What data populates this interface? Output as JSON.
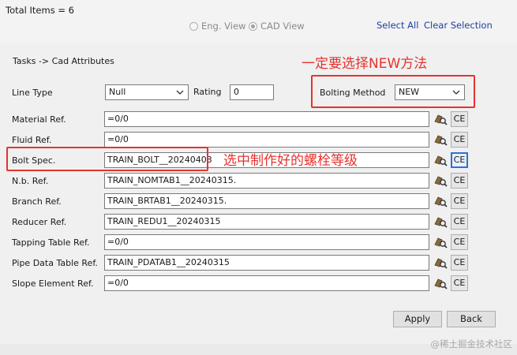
{
  "header": {
    "total_items": "Total Items = 6",
    "views": [
      {
        "label": "Eng. View",
        "selected": false
      },
      {
        "label": "CAD View",
        "selected": true
      }
    ],
    "select_all": "Select All",
    "clear_selection": "Clear Selection"
  },
  "group": {
    "title": "Tasks -> Cad Attributes"
  },
  "line_type": {
    "label": "Line Type",
    "value": "Null"
  },
  "rating": {
    "label": "Rating",
    "value": "0"
  },
  "bolting_method": {
    "label": "Bolting Method",
    "value": "NEW"
  },
  "rows": [
    {
      "label": "Material Ref.",
      "value": "=0/0",
      "ce": "CE"
    },
    {
      "label": "Fluid Ref.",
      "value": "=0/0",
      "ce": "CE"
    },
    {
      "label": "Bolt Spec.",
      "value": "TRAIN_BOLT__20240403",
      "ce": "CE"
    },
    {
      "label": "N.b. Ref.",
      "value": "TRAIN_NOMTAB1__20240315.",
      "ce": "CE"
    },
    {
      "label": "Branch Ref.",
      "value": "TRAIN_BRTAB1__20240315.",
      "ce": "CE"
    },
    {
      "label": "Reducer Ref.",
      "value": "TRAIN_REDU1__20240315",
      "ce": "CE"
    },
    {
      "label": "Tapping Table Ref.",
      "value": "=0/0",
      "ce": "CE"
    },
    {
      "label": "Pipe Data Table Ref.",
      "value": "TRAIN_PDATAB1__20240315",
      "ce": "CE"
    },
    {
      "label": "Slope Element Ref.",
      "value": "=0/0",
      "ce": "CE"
    }
  ],
  "buttons": {
    "apply": "Apply",
    "back": "Back"
  },
  "annotations": {
    "bolting_note": "一定要选择NEW方法",
    "bolt_spec_note": "选中制作好的螺栓等级"
  },
  "watermark": "@稀土掘金技术社区",
  "colors": {
    "annotation_red": "#e5332f",
    "link_blue": "#1f3f9f",
    "focus_blue": "#2f6fd6"
  },
  "icons": [
    "radio-icon",
    "pick-element-icon",
    "chevron-down-icon"
  ]
}
